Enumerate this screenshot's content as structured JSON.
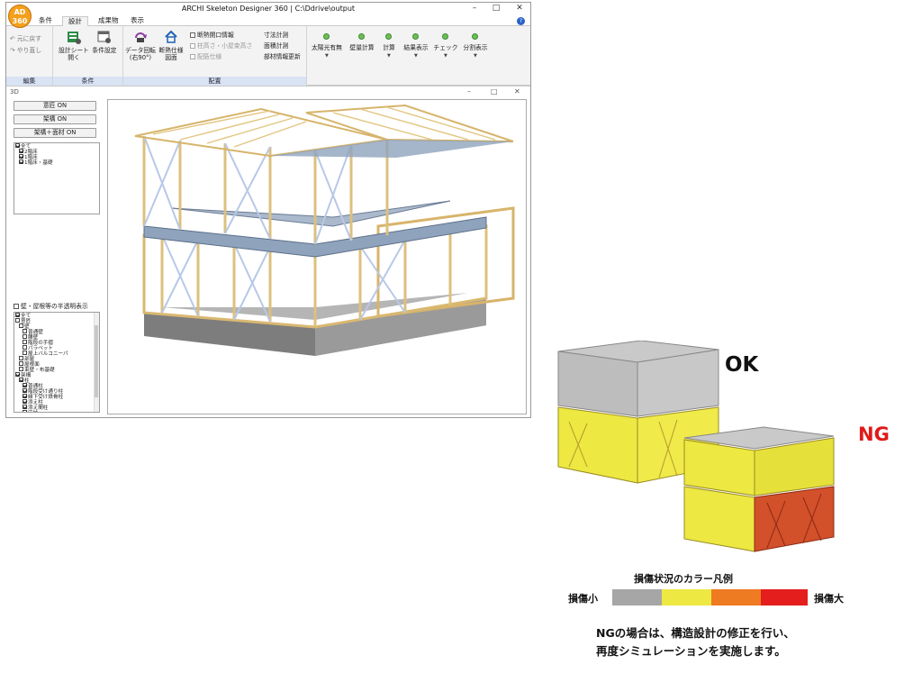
{
  "window": {
    "logo_text": "AD 360",
    "title": "ARCHI Skeleton Designer 360 | C:\\Ddrive\\output",
    "min": "–",
    "max": "□",
    "close": "✕"
  },
  "tabs": [
    "条件",
    "設計",
    "成果物",
    "表示"
  ],
  "active_tab": "設計",
  "help": "?",
  "ribbon": {
    "edit": {
      "undo": "元に戻す",
      "redo": "やり直し",
      "label": "編集"
    },
    "cond": {
      "sheet_line1": "設計シート",
      "sheet_line2": "開く",
      "setting": "条件設定",
      "label": "条件"
    },
    "layout": {
      "rotate_line1": "データ回転",
      "rotate_line2": "(右90°)",
      "insul_line1": "断熱仕様",
      "insul_line2": "図面",
      "chk_opening": "断熱開口情報",
      "chk_height": "柱高さ・小屋束高さ",
      "chk_pipe": "配筋仕様",
      "dim": "寸法計測",
      "area": "面積計測",
      "update": "部材情報更新",
      "label": "配置"
    },
    "solar": "太陽光有無",
    "wall": "壁量計算",
    "calc": "計算",
    "result": "結果表示",
    "check": "チェック",
    "split": "分割表示"
  },
  "child": {
    "title": "3D",
    "min": "–",
    "max": "□",
    "close": "✕"
  },
  "panel": {
    "btn_design": "意匠 ON",
    "btn_frame": "架構 ON",
    "btn_frame_face": "架構＋面材 ON",
    "floors": [
      {
        "label": "全て",
        "checked": true,
        "indent": 0
      },
      {
        "label": "2階床",
        "checked": true,
        "indent": 1
      },
      {
        "label": "1階床",
        "checked": true,
        "indent": 1
      },
      {
        "label": "1階床・基礎",
        "checked": true,
        "indent": 1
      }
    ],
    "semi": "壁・屋根等の半透明表示",
    "tree": [
      {
        "label": "全て",
        "checked": true,
        "indent": 0
      },
      {
        "label": "意匠",
        "checked": false,
        "indent": 0
      },
      {
        "label": "壁",
        "checked": false,
        "indent": 1
      },
      {
        "label": "普通壁",
        "checked": false,
        "indent": 2
      },
      {
        "label": "腰壁",
        "checked": false,
        "indent": 2
      },
      {
        "label": "階段の手摺",
        "checked": false,
        "indent": 2
      },
      {
        "label": "パラペット",
        "checked": false,
        "indent": 2
      },
      {
        "label": "屋上バルコニーパ",
        "checked": false,
        "indent": 2
      },
      {
        "label": "部屋",
        "checked": false,
        "indent": 1
      },
      {
        "label": "屋根面",
        "checked": false,
        "indent": 1
      },
      {
        "label": "束壁・布基礎",
        "checked": false,
        "indent": 1
      },
      {
        "label": "架構",
        "checked": true,
        "indent": 0
      },
      {
        "label": "柱",
        "checked": true,
        "indent": 1
      },
      {
        "label": "普通柱",
        "checked": true,
        "indent": 2
      },
      {
        "label": "階段受け通り柱",
        "checked": true,
        "indent": 2
      },
      {
        "label": "縁下受け鉄骨柱",
        "checked": true,
        "indent": 2
      },
      {
        "label": "添え柱",
        "checked": true,
        "indent": 2
      },
      {
        "label": "添え間柱",
        "checked": true,
        "indent": 2
      },
      {
        "label": "床柱",
        "checked": true,
        "indent": 2
      },
      {
        "label": "平柱",
        "checked": true,
        "indent": 2
      },
      {
        "label": "テク/柱",
        "checked": true,
        "indent": 2
      },
      {
        "label": "構柱",
        "checked": true,
        "indent": 2
      },
      {
        "label": "半階層端柱",
        "checked": true,
        "indent": 2
      },
      {
        "label": "横架材",
        "checked": true,
        "indent": 1
      },
      {
        "label": "テクノビーム",
        "checked": true,
        "indent": 2
      }
    ]
  },
  "figure": {
    "ok": "OK",
    "ng": "NG",
    "legend_title": "損傷状況のカラー凡例",
    "legend_low": "損傷小",
    "legend_high": "損傷大",
    "legend_colors": [
      "#a6a6a6",
      "#ede842",
      "#ee7a22",
      "#e41d1d"
    ],
    "note_line1": "NGの場合は、構造設計の修正を行い、",
    "note_line2": "再度シミュレーションを実施します。"
  }
}
